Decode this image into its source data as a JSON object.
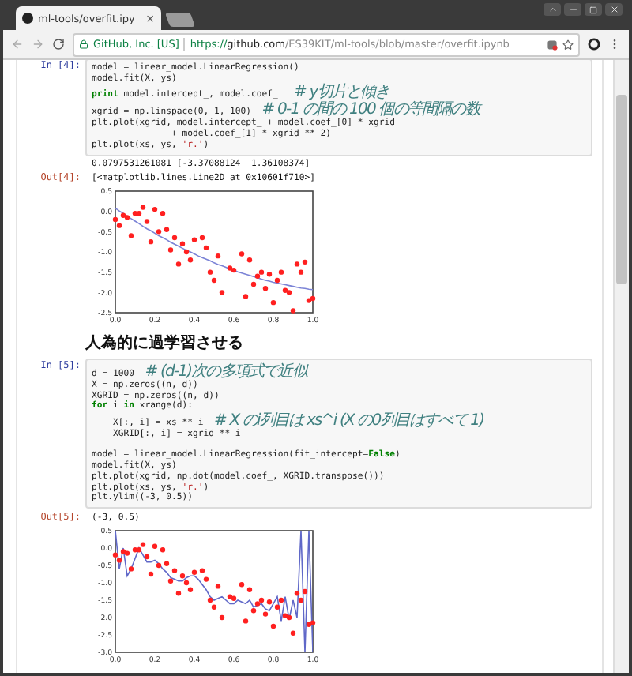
{
  "browser": {
    "tab_title": "ml-tools/overfit.ipy",
    "tab_close": "×",
    "site_identity": "GitHub, Inc. [US]",
    "url": {
      "scheme": "https://",
      "host": "github.com",
      "path": "/ES39KIT/ml-tools/blob/master/overfit.ipynb"
    }
  },
  "cells": [
    {
      "kind": "code",
      "prompt": "In [4]:",
      "lines": [
        {
          "kind": "code",
          "tokens": [
            {
              "kind": "plain",
              "t": "model = linear_model.LinearRegression()"
            }
          ]
        },
        {
          "kind": "code",
          "tokens": [
            {
              "kind": "plain",
              "t": "model.fit(X, ys)"
            }
          ]
        },
        {
          "kind": "code",
          "tokens": [
            {
              "kind": "keyword",
              "t": "print"
            },
            {
              "kind": "plain",
              "t": " model.intercept_, model.coef_   "
            },
            {
              "kind": "comment",
              "t": "# y切片と傾き"
            }
          ]
        },
        {
          "kind": "code",
          "tokens": [
            {
              "kind": "plain",
              "t": "xgrid = np.linspace(0, 1, 100)  "
            },
            {
              "kind": "comment",
              "t": "# 0-1 の間の 100 個の等間隔の数"
            }
          ]
        },
        {
          "kind": "code",
          "tokens": [
            {
              "kind": "plain",
              "t": "plt.plot(xgrid, model.intercept_ + model.coef_[0] * xgrid"
            }
          ]
        },
        {
          "kind": "code",
          "tokens": [
            {
              "kind": "plain",
              "t": "               + model.coef_[1] * xgrid ** 2)"
            }
          ]
        },
        {
          "kind": "code",
          "tokens": [
            {
              "kind": "plain",
              "t": "plt.plot(xs, ys, "
            },
            {
              "kind": "string",
              "t": "'r.'"
            },
            {
              "kind": "plain",
              "t": ")"
            }
          ]
        }
      ],
      "stdout": "0.0797531261081 [-3.37088124  1.36108374]",
      "out_prompt": "Out[4]:",
      "out_text": "[<matplotlib.lines.Line2D at 0x10601f710>]",
      "chart_data": {
        "type": "scatter",
        "xlim": [
          0,
          1
        ],
        "ylim": [
          -2.5,
          0.5
        ],
        "x": [
          0,
          0.02,
          0.04,
          0.06,
          0.08,
          0.1,
          0.12,
          0.14,
          0.16,
          0.18,
          0.2,
          0.22,
          0.24,
          0.26,
          0.28,
          0.3,
          0.32,
          0.34,
          0.36,
          0.38,
          0.4,
          0.42,
          0.44,
          0.46,
          0.48,
          0.5,
          0.52,
          0.54,
          0.56,
          0.58,
          0.6,
          0.62,
          0.64,
          0.66,
          0.68,
          0.7,
          0.72,
          0.74,
          0.76,
          0.78,
          0.8,
          0.82,
          0.84,
          0.86,
          0.88,
          0.9,
          0.92,
          0.94,
          0.96,
          0.98,
          1
        ],
        "xticks": [
          {
            "value": 0,
            "label": "0.0"
          },
          {
            "value": 0.2,
            "label": "0.2"
          },
          {
            "value": 0.4,
            "label": "0.4"
          },
          {
            "value": 0.6,
            "label": "0.6"
          },
          {
            "value": 0.8,
            "label": "0.8"
          },
          {
            "value": 1,
            "label": "1.0"
          }
        ],
        "yticks": [
          {
            "value": -2.5,
            "label": "-2.5"
          },
          {
            "value": -2,
            "label": "-2.0"
          },
          {
            "value": -1.5,
            "label": "-1.5"
          },
          {
            "value": -1,
            "label": "-1.0"
          },
          {
            "value": -0.5,
            "label": "-0.5"
          },
          {
            "value": 0,
            "label": "0.0"
          },
          {
            "value": 0.5,
            "label": "0.5"
          }
        ],
        "series": [
          {
            "type": "line",
            "color": "#7b83d6",
            "values": [
              0.08,
              0.01,
              -0.05,
              -0.12,
              -0.18,
              -0.24,
              -0.3,
              -0.37,
              -0.43,
              -0.48,
              -0.54,
              -0.6,
              -0.65,
              -0.7,
              -0.76,
              -0.81,
              -0.86,
              -0.91,
              -0.96,
              -1,
              -1.05,
              -1.1,
              -1.14,
              -1.18,
              -1.22,
              -1.27,
              -1.31,
              -1.34,
              -1.38,
              -1.42,
              -1.45,
              -1.49,
              -1.52,
              -1.55,
              -1.58,
              -1.61,
              -1.64,
              -1.67,
              -1.7,
              -1.72,
              -1.75,
              -1.77,
              -1.79,
              -1.81,
              -1.83,
              -1.85,
              -1.87,
              -1.89,
              -1.9,
              -1.92,
              -1.93
            ]
          },
          {
            "type": "scatter",
            "color": "#ff2020",
            "values": [
              -0.2,
              -0.35,
              -0.1,
              -0.15,
              -0.6,
              -0.05,
              -0.05,
              0.1,
              -0.25,
              -0.75,
              0.05,
              -0.5,
              -0.05,
              -0.45,
              -0.95,
              -0.65,
              -1.3,
              -0.8,
              -1,
              -1.2,
              -0.7,
              null,
              -0.65,
              -0.9,
              -1.5,
              -1.7,
              -1.1,
              -2,
              null,
              -1.4,
              -1.45,
              null,
              -1.05,
              -2.1,
              -1.2,
              -1.8,
              -1.6,
              -1.5,
              -1.9,
              -1.55,
              -2.25,
              -1.7,
              -1.5,
              -1.95,
              -2,
              -2.45,
              -1.3,
              -1.5,
              -1.25,
              -2.2,
              -2.15
            ]
          }
        ]
      }
    },
    {
      "kind": "heading",
      "text": "人為的に過学習させる"
    },
    {
      "kind": "code",
      "prompt": "In [5]:",
      "lines": [
        {
          "kind": "code",
          "tokens": [
            {
              "kind": "plain",
              "t": "d = 1000  "
            },
            {
              "kind": "comment",
              "t": "# (d-1)次の多項式で近似"
            }
          ]
        },
        {
          "kind": "code",
          "tokens": [
            {
              "kind": "plain",
              "t": "X = np.zeros((n, d))"
            }
          ]
        },
        {
          "kind": "code",
          "tokens": [
            {
              "kind": "plain",
              "t": "XGRID = np.zeros((n, d))"
            }
          ]
        },
        {
          "kind": "code",
          "tokens": [
            {
              "kind": "keyword",
              "t": "for"
            },
            {
              "kind": "plain",
              "t": " i "
            },
            {
              "kind": "keyword",
              "t": "in"
            },
            {
              "kind": "plain",
              "t": " xrange(d):"
            }
          ]
        },
        {
          "kind": "code",
          "tokens": [
            {
              "kind": "plain",
              "t": "    X[:, i] = xs ** i  "
            },
            {
              "kind": "comment",
              "t": "# X のi列目は xs^i (X の0列目はすべて 1)"
            }
          ]
        },
        {
          "kind": "code",
          "tokens": [
            {
              "kind": "plain",
              "t": "    XGRID[:, i] = xgrid ** i"
            }
          ]
        },
        {
          "kind": "blank"
        },
        {
          "kind": "code",
          "tokens": [
            {
              "kind": "plain",
              "t": "model = linear_model.LinearRegression(fit_intercept="
            },
            {
              "kind": "keyword",
              "t": "False"
            },
            {
              "kind": "plain",
              "t": ")"
            }
          ]
        },
        {
          "kind": "code",
          "tokens": [
            {
              "kind": "plain",
              "t": "model.fit(X, ys)"
            }
          ]
        },
        {
          "kind": "code",
          "tokens": [
            {
              "kind": "plain",
              "t": "plt.plot(xgrid, np.dot(model.coef_, XGRID.transpose()))"
            }
          ]
        },
        {
          "kind": "code",
          "tokens": [
            {
              "kind": "plain",
              "t": "plt.plot(xs, ys, "
            },
            {
              "kind": "string",
              "t": "'r.'"
            },
            {
              "kind": "plain",
              "t": ")"
            }
          ]
        },
        {
          "kind": "code",
          "tokens": [
            {
              "kind": "plain",
              "t": "plt.ylim((-3, 0.5))"
            }
          ]
        }
      ],
      "out_prompt": "Out[5]:",
      "out_text": "(-3, 0.5)",
      "chart_data": {
        "type": "scatter",
        "xlim": [
          0,
          1
        ],
        "ylim": [
          -3,
          0.5
        ],
        "x": [
          0,
          0.02,
          0.04,
          0.06,
          0.08,
          0.1,
          0.12,
          0.14,
          0.16,
          0.18,
          0.2,
          0.22,
          0.24,
          0.26,
          0.28,
          0.3,
          0.32,
          0.34,
          0.36,
          0.38,
          0.4,
          0.42,
          0.44,
          0.46,
          0.48,
          0.5,
          0.52,
          0.54,
          0.56,
          0.58,
          0.6,
          0.62,
          0.64,
          0.66,
          0.68,
          0.7,
          0.72,
          0.74,
          0.76,
          0.78,
          0.8,
          0.82,
          0.84,
          0.86,
          0.88,
          0.9,
          0.92,
          0.94,
          0.96,
          0.98,
          1
        ],
        "xticks": [
          {
            "value": 0,
            "label": "0.0"
          },
          {
            "value": 0.2,
            "label": "0.2"
          },
          {
            "value": 0.4,
            "label": "0.4"
          },
          {
            "value": 0.6,
            "label": "0.6"
          },
          {
            "value": 0.8,
            "label": "0.8"
          },
          {
            "value": 1,
            "label": "1.0"
          }
        ],
        "yticks": [
          {
            "value": -3,
            "label": "-3.0"
          },
          {
            "value": -2.5,
            "label": "-2.5"
          },
          {
            "value": -2,
            "label": "-2.0"
          },
          {
            "value": -1.5,
            "label": "-1.5"
          },
          {
            "value": -1,
            "label": "-1.0"
          },
          {
            "value": -0.5,
            "label": "-0.5"
          },
          {
            "value": 0,
            "label": "0.0"
          },
          {
            "value": 0.5,
            "label": "0.5"
          }
        ],
        "series": [
          {
            "type": "line",
            "color": "#6068c8",
            "values": [
              0.5,
              -0.6,
              0,
              -0.8,
              -0.6,
              -0.3,
              0,
              -0.2,
              -0.4,
              -0.4,
              -0.35,
              -0.45,
              -0.6,
              -0.7,
              -0.85,
              -0.9,
              -0.95,
              -0.95,
              -0.85,
              -0.8,
              -0.8,
              -0.9,
              -1.05,
              -1.2,
              -1.4,
              -1.5,
              -1.45,
              -1.4,
              -1.5,
              -1.6,
              -1.6,
              -1.5,
              -1.55,
              -1.6,
              -1.5,
              -1.7,
              -1.65,
              -1.6,
              -1.75,
              -1.8,
              -1.6,
              -1.4,
              -2.1,
              -1.4,
              -2.05,
              -1.5,
              -2,
              0.5,
              -3,
              0.5,
              -3
            ]
          },
          {
            "type": "scatter",
            "color": "#ff2020",
            "values": [
              -0.2,
              -0.35,
              -0.1,
              -0.15,
              -0.6,
              -0.05,
              -0.05,
              0.1,
              -0.25,
              -0.75,
              0.05,
              -0.5,
              -0.05,
              -0.45,
              -0.95,
              -0.65,
              -1.3,
              -0.8,
              -1,
              -1.2,
              -0.7,
              null,
              -0.65,
              -0.9,
              -1.5,
              -1.7,
              -1.1,
              -2,
              null,
              -1.4,
              -1.45,
              null,
              -1.05,
              -2.1,
              -1.2,
              -1.8,
              -1.6,
              -1.5,
              -1.9,
              -1.55,
              -2.25,
              -1.7,
              -1.5,
              -1.95,
              -2,
              -2.45,
              -1.3,
              -1.5,
              -1.25,
              -2.2,
              -2.15
            ]
          }
        ]
      }
    }
  ]
}
